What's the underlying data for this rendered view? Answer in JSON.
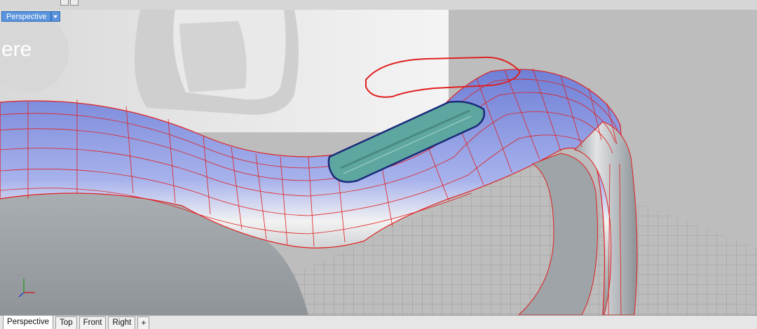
{
  "viewport": {
    "title": "Perspective",
    "background_color": "#b9b9b9",
    "surface_color": "#7f8fd8",
    "isocurve_color": "#e02020",
    "boundary_color": "#1a2a7a",
    "cutout_fill": "#5ea7a0",
    "axis_icon": "world-axes-icon",
    "watermark": "ere"
  },
  "tabs": [
    {
      "label": "Perspective",
      "active": true
    },
    {
      "label": "Top",
      "active": false
    },
    {
      "label": "Front",
      "active": false
    },
    {
      "label": "Right",
      "active": false
    }
  ],
  "add_tab_label": "+"
}
